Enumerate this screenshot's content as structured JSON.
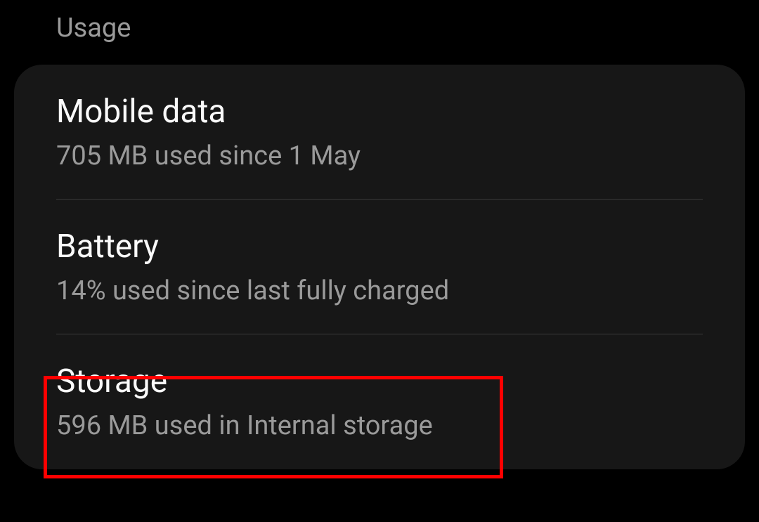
{
  "section": {
    "header": "Usage"
  },
  "items": {
    "mobile_data": {
      "title": "Mobile data",
      "subtitle": "705 MB used since 1 May"
    },
    "battery": {
      "title": "Battery",
      "subtitle": "14% used since last fully charged"
    },
    "storage": {
      "title": "Storage",
      "subtitle": "596 MB used in Internal storage"
    }
  }
}
